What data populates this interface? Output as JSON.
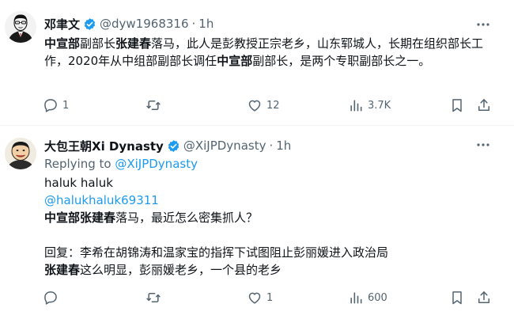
{
  "tweet1": {
    "name": "邓聿文",
    "handle": "@dyw1968316",
    "time": "1h",
    "text_parts": [
      {
        "t": "中宣部",
        "bold": true
      },
      {
        "t": "副部长",
        "bold": false
      },
      {
        "t": "张建春",
        "bold": true
      },
      {
        "t": "落马，此人是彭教授正宗老乡，山东郓城人，长期在组织部长工作，2020年从中组部副部长调任",
        "bold": false
      },
      {
        "t": "中宣部",
        "bold": true
      },
      {
        "t": "副部长，是两个专职副部长之一。",
        "bold": false
      }
    ],
    "actions": {
      "replies": "1",
      "retweets": "",
      "likes": "12",
      "views": "3.7K"
    }
  },
  "tweet2": {
    "name": "大包王朝Xi Dynasty",
    "handle": "@XiJPDynasty",
    "time": "1h",
    "replying_label": "Replying to ",
    "replying_handle": "@XiJPDynasty",
    "quoted_name": "haluk haluk",
    "quoted_handle": "@halukhaluk69311",
    "line1": {
      "b1": "中宣部张建春",
      "r1": "落马，最近怎么密集抓人？"
    },
    "line2": "回复：李希在胡锦涛和温家宝的指挥下试图阻止彭丽媛进入政治局",
    "line3": {
      "b1": "张建春",
      "r1": "这么明显，彭丽媛老乡，一个县的老乡"
    },
    "actions": {
      "replies": "",
      "retweets": "",
      "likes": "1",
      "views": "600"
    }
  },
  "separator": "·",
  "colors": {
    "accent": "#1d9bf0",
    "muted": "#536471",
    "text": "#0f1419",
    "divider": "#eff3f4"
  }
}
